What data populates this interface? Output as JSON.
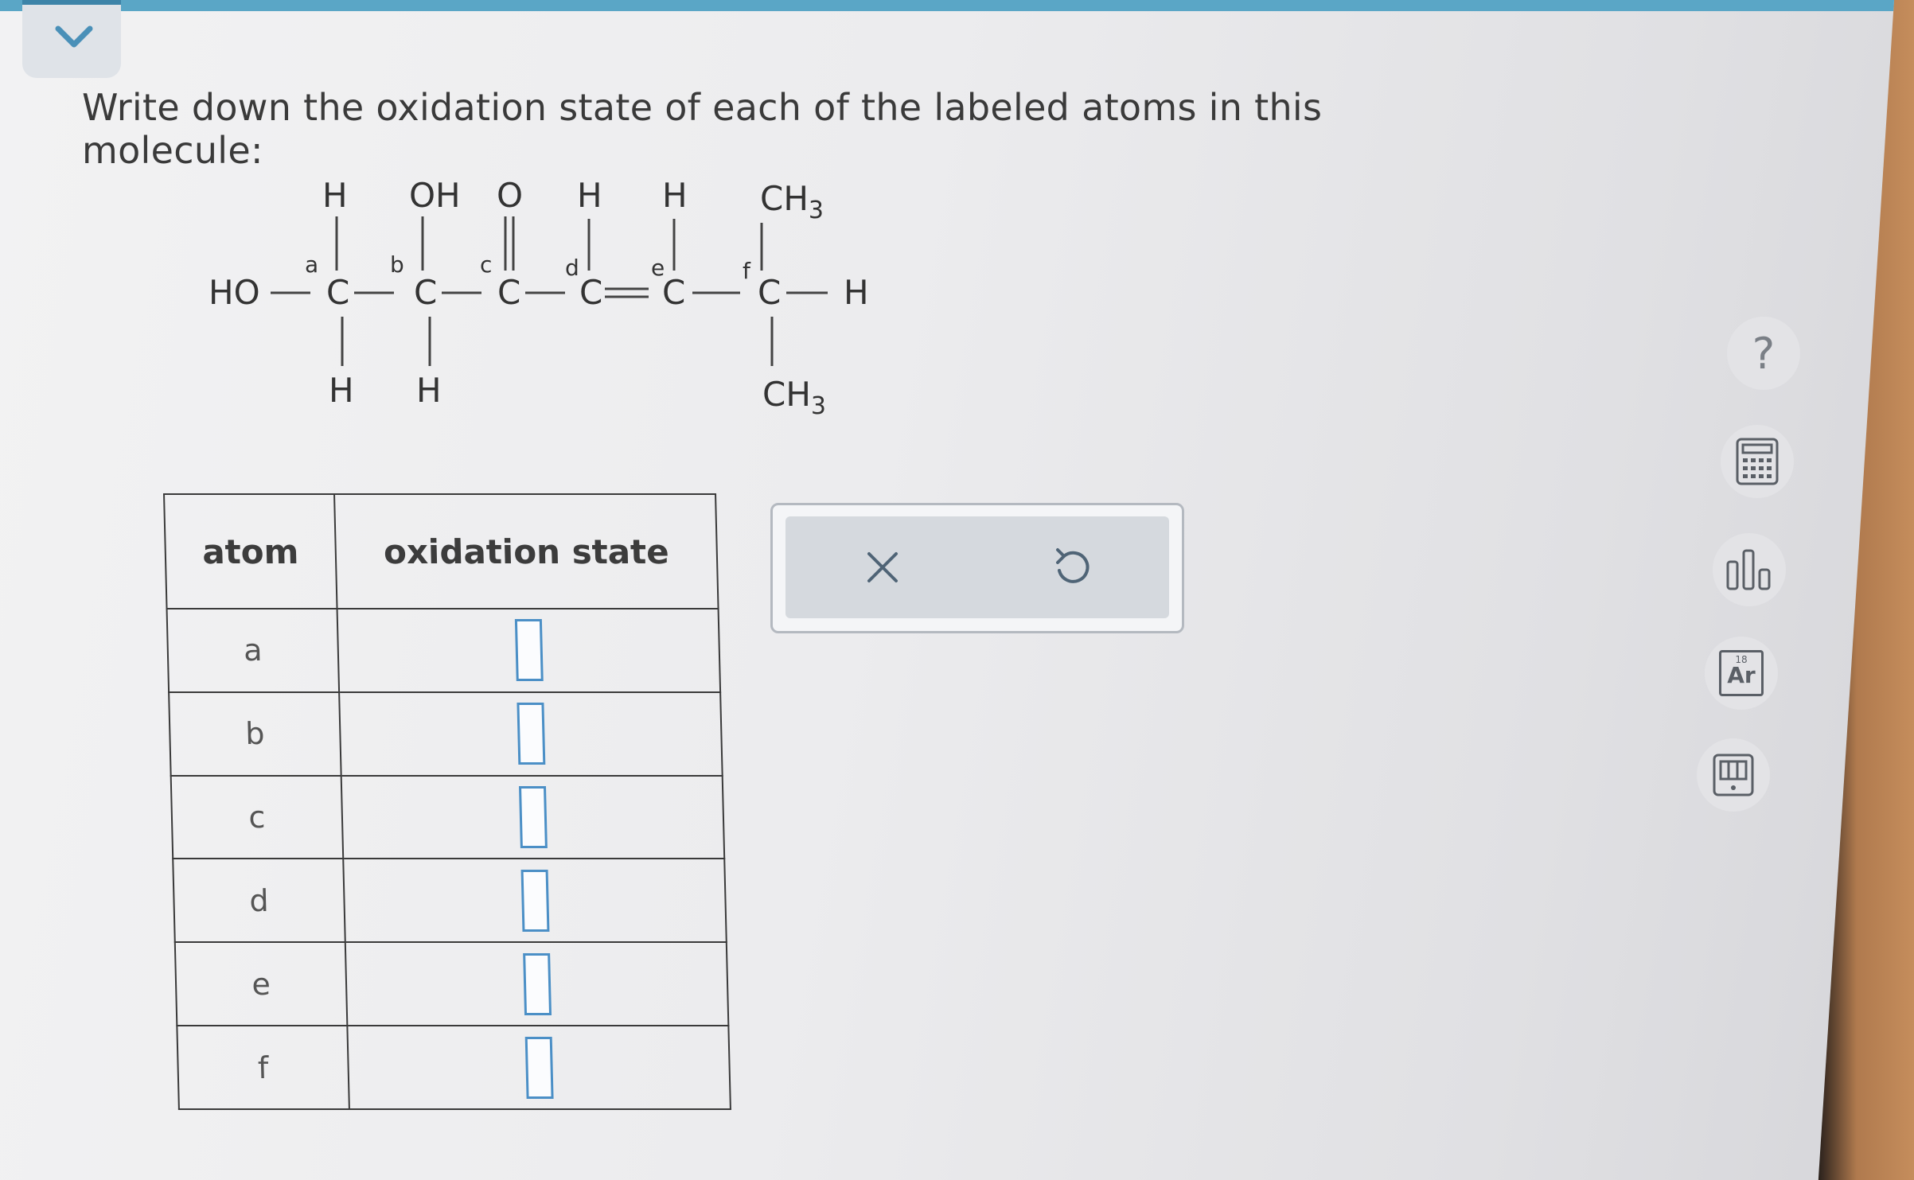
{
  "question": {
    "prompt": "Write down the oxidation state of each of the labeled atoms in this molecule:"
  },
  "molecule": {
    "left_group": "HO",
    "top_substituents": [
      "H",
      "OH",
      "O",
      "H",
      "H",
      "CH3"
    ],
    "bottom_substituents": [
      "H",
      "H",
      "CH3"
    ],
    "right_end": "H",
    "backbone_atom": "C",
    "atom_labels": [
      "a",
      "b",
      "c",
      "d",
      "e",
      "f"
    ]
  },
  "table": {
    "headers": [
      "atom",
      "oxidation state"
    ],
    "rows": [
      {
        "atom": "a",
        "value": ""
      },
      {
        "atom": "b",
        "value": ""
      },
      {
        "atom": "c",
        "value": ""
      },
      {
        "atom": "d",
        "value": ""
      },
      {
        "atom": "e",
        "value": ""
      },
      {
        "atom": "f",
        "value": ""
      }
    ]
  },
  "actions": {
    "clear_icon": "close-icon",
    "undo_icon": "undo-icon"
  },
  "toolbar": {
    "help_label": "?",
    "periodic_table_number": "18",
    "periodic_table_symbol": "Ar",
    "icons": [
      "help-icon",
      "calculator-icon",
      "chart-icon",
      "periodic-table-icon",
      "reference-book-icon"
    ]
  },
  "colors": {
    "accent_bar": "#5aa6c6",
    "input_border": "#4b8fc6",
    "collapse_chevron": "#4a90b8"
  }
}
